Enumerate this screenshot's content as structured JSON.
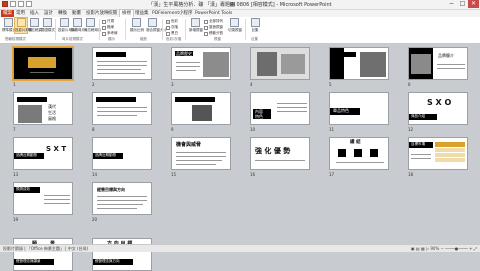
{
  "window": {
    "title": "「漢」生平風格分析．礦 「漢」專題᭍ 0806 [相容模式] - Microsoft PowerPoint",
    "controls": [
      "−",
      "□",
      "✕"
    ]
  },
  "tabs": [
    "檔案",
    "常用",
    "插入",
    "設計",
    "轉換",
    "動畫",
    "投影片放映",
    "校閱",
    "檢視",
    "增益集",
    "PDFelement",
    "小程序",
    "PowerPoint Tools"
  ],
  "ribbon": {
    "buttons": [
      "標準模式",
      "投影片節錄",
      "備忘稿頁",
      "閱讀模式",
      "投影片母片",
      "講義母片",
      "備忘稿母片",
      "顯示比例",
      "適合視窗大小",
      "新增視窗",
      "切換視窗",
      "巨集"
    ],
    "checks": [
      "尺規",
      "格線",
      "參考線",
      "色彩",
      "灰階",
      "黑白"
    ],
    "side": [
      "全部排列",
      "重疊視窗",
      "移動分割"
    ],
    "groups": [
      "簡報檢視模式",
      "母片檢視模式",
      "顯示",
      "縮放",
      "色彩/灰階",
      "視窗",
      "巨集"
    ]
  },
  "slides": {
    "numbers": [
      "1",
      "2",
      "3",
      "4",
      "5",
      "6",
      "7",
      "8",
      "9",
      "10",
      "11",
      "12",
      "13",
      "14",
      "15",
      "16",
      "17",
      "18",
      "19",
      "20",
      "21",
      "22",
      "23",
      "24",
      "25",
      "26"
    ],
    "texts": {
      "s3": "品牌歷史",
      "s6": "品牌簡介",
      "s7a": "漢代",
      "s7b": "生活",
      "s7c": "風格",
      "s11": "內容",
      "s11b": "特色",
      "s13": "單品特色",
      "s14": "商品介紹",
      "s15": "S X O",
      "s16": "品牌近期動態",
      "s17": "S X T",
      "s18": "品牌近期動態",
      "s19": "機會與威脅",
      "s20": "強 化 優 勢",
      "s21": "總 結",
      "s22": "目標市場",
      "s23": "預測成效",
      "s24": "經營目標與方向",
      "s25a": "願",
      "s25b": "景",
      "s25c": "經營理念與願景",
      "s26a": "方 向 目 標",
      "s26b": "經營理念與方向"
    }
  },
  "status": {
    "left": "投影片節錄 | 「Office 佈景主題」 | 中文 (台灣)",
    "right": "▣ ▤ ▦ ▷   90%   − ────●──── +   ⤢"
  }
}
